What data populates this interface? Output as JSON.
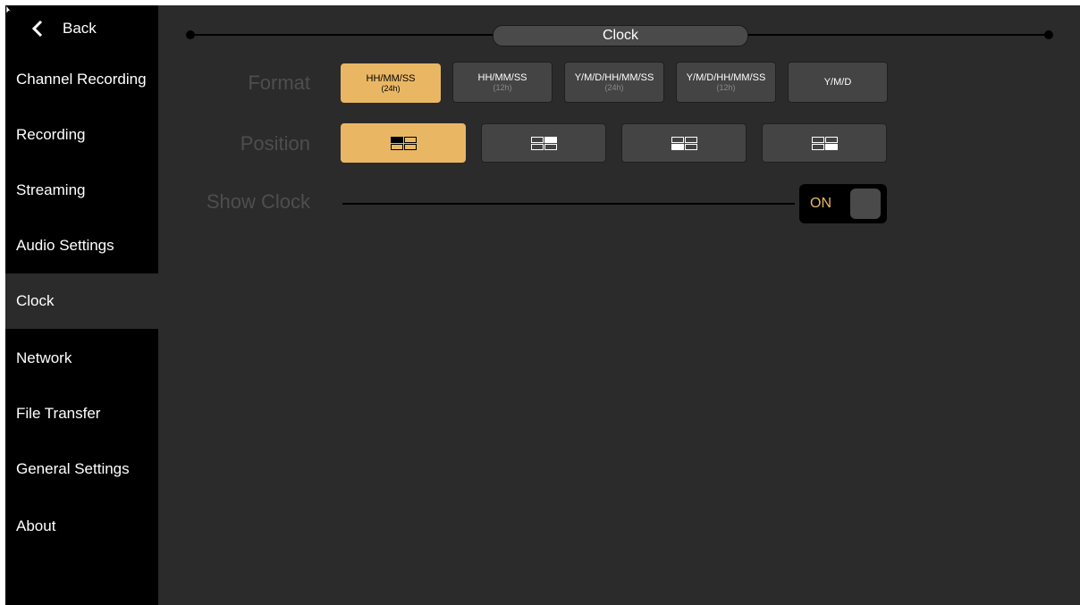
{
  "sidebar": {
    "back_label": "Back",
    "items": [
      {
        "label": "Channel Recording"
      },
      {
        "label": "Recording"
      },
      {
        "label": "Streaming"
      },
      {
        "label": "Audio Settings"
      },
      {
        "label": "Clock"
      },
      {
        "label": "Network"
      },
      {
        "label": "File Transfer"
      },
      {
        "label": "General Settings"
      },
      {
        "label": "About"
      }
    ],
    "active": "Clock"
  },
  "header": {
    "title": "Clock"
  },
  "format": {
    "label": "Format",
    "options": [
      {
        "main": "HH/MM/SS",
        "sub": "(24h)"
      },
      {
        "main": "HH/MM/SS",
        "sub": "(12h)"
      },
      {
        "main": "Y/M/D/HH/MM/SS",
        "sub": "(24h)"
      },
      {
        "main": "Y/M/D/HH/MM/SS",
        "sub": "(12h)"
      },
      {
        "main": "Y/M/D",
        "sub": ""
      }
    ],
    "selected_index": 0
  },
  "position": {
    "label": "Position",
    "options": [
      "top-left",
      "top-right",
      "bottom-left",
      "bottom-right"
    ],
    "selected_index": 0
  },
  "show_clock": {
    "label": "Show Clock",
    "state": "ON"
  },
  "colors": {
    "accent": "#e9b764",
    "background": "#2b2b2b",
    "sidebar": "#000000"
  }
}
